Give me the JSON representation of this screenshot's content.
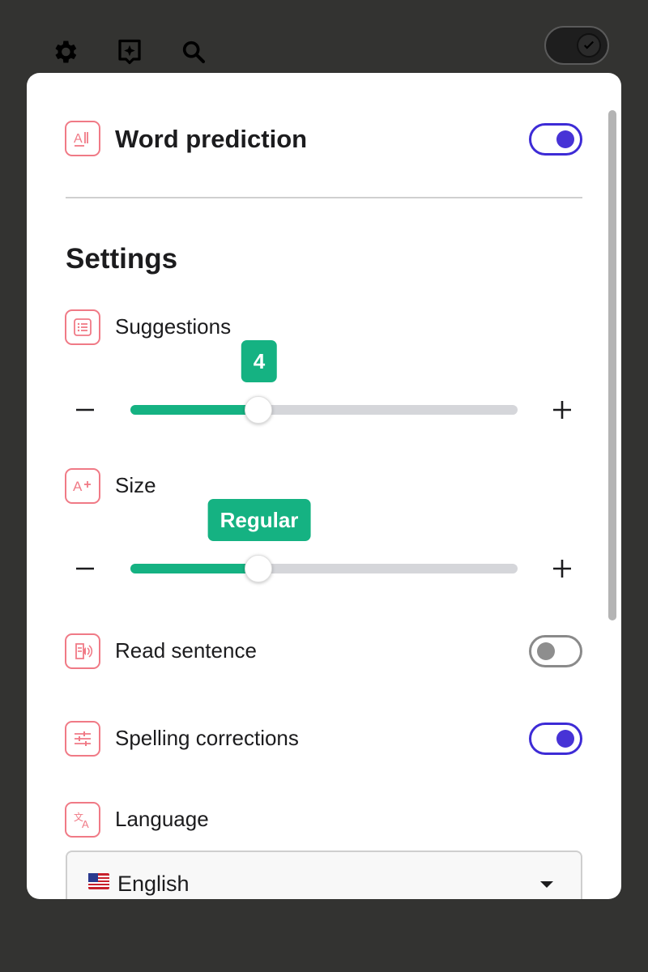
{
  "colors": {
    "accent_toggle": "#4733d6",
    "slider_fill": "#15b282",
    "icon_outline": "#f07a86"
  },
  "header": {
    "title": "Word prediction",
    "enabled": true
  },
  "settings": {
    "title": "Settings",
    "suggestions": {
      "label": "Suggestions",
      "value": "4",
      "level": 0.33
    },
    "size": {
      "label": "Size",
      "value": "Regular",
      "level": 0.33
    },
    "read_sentence": {
      "label": "Read sentence",
      "enabled": false
    },
    "spelling_corrections": {
      "label": "Spelling corrections",
      "enabled": true
    },
    "language": {
      "label": "Language",
      "selected": "English",
      "flag": "US"
    }
  },
  "icons": {
    "toolbar": [
      "gear-icon",
      "sparkle-icon",
      "search-icon"
    ],
    "features": [
      "text-ai-icon",
      "list-icon",
      "text-size-icon",
      "speaker-icon",
      "sliders-icon",
      "translate-icon"
    ]
  }
}
